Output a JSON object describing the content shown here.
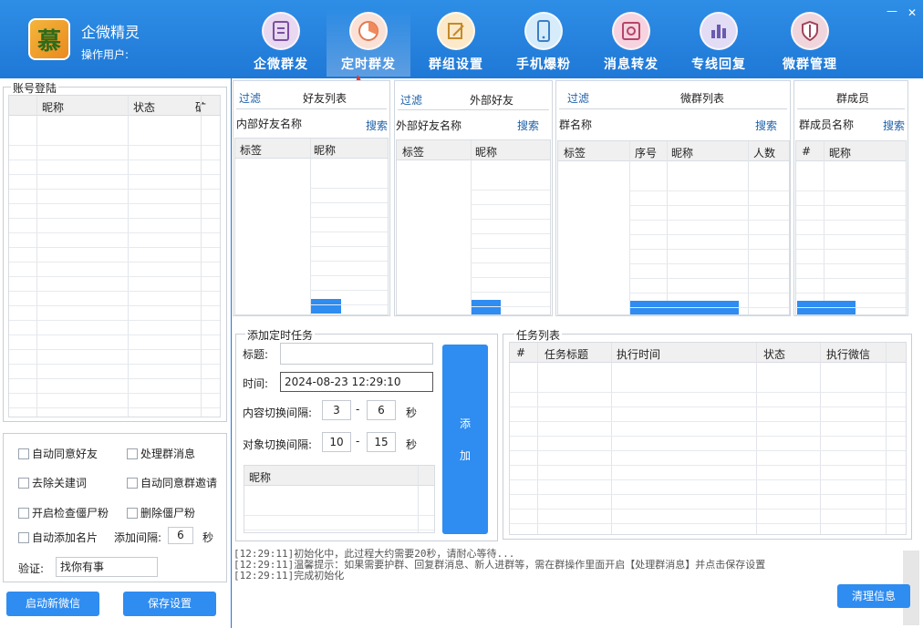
{
  "app": {
    "title": "企微精灵",
    "user_label": "操作用户:",
    "logo_char": "慕"
  },
  "nav": [
    {
      "label": "企微群发",
      "icon": "document-icon"
    },
    {
      "label": "定时群发",
      "icon": "pie-chart-icon"
    },
    {
      "label": "群组设置",
      "icon": "edit-icon"
    },
    {
      "label": "手机爆粉",
      "icon": "phone-icon"
    },
    {
      "label": "消息转发",
      "icon": "safe-icon"
    },
    {
      "label": "专线回复",
      "icon": "bar-chart-icon"
    },
    {
      "label": "微群管理",
      "icon": "shield-icon"
    }
  ],
  "window": {
    "minimize": "—",
    "close": "✕"
  },
  "account": {
    "legend": "账号登陆",
    "columns": [
      "昵称",
      "状态",
      "矿"
    ]
  },
  "friends": {
    "filter": "过滤",
    "title": "好友列表",
    "field_label": "内部好友名称",
    "search": "搜索",
    "columns": [
      "标签",
      "昵称"
    ]
  },
  "external": {
    "filter": "过滤",
    "title": "外部好友",
    "field_label": "外部好友名称",
    "search": "搜索",
    "columns": [
      "标签",
      "昵称"
    ]
  },
  "groups": {
    "filter": "过滤",
    "title": "微群列表",
    "field_label": "群名称",
    "search": "搜索",
    "columns": [
      "标签",
      "序号",
      "昵称",
      "人数"
    ]
  },
  "members": {
    "title": "群成员",
    "field_label": "群成员名称",
    "search": "搜索",
    "columns": [
      "#",
      "昵称"
    ]
  },
  "options": {
    "auto_accept_friend": "自动同意好友",
    "handle_group_msg": "处理群消息",
    "remove_keywords": "去除关建词",
    "auto_accept_group_invite": "自动同意群邀请",
    "check_zombie": "开启检查僵尸粉",
    "delete_zombie": "删除僵尸粉",
    "auto_add_card": "自动添加名片",
    "interval_label": "添加间隔:",
    "interval_value": "6",
    "interval_unit": "秒",
    "verify_label": "验证:",
    "verify_value": "找你有事"
  },
  "bottom_buttons": {
    "start_wechat": "启动新微信",
    "save_settings": "保存设置"
  },
  "task_form": {
    "legend": "添加定时任务",
    "title_label": "标题:",
    "title_value": "",
    "time_label": "时间:",
    "time_value": "2024-08-23 12:29:10",
    "content_interval_label": "内容切换间隔:",
    "content_min": "3",
    "content_max": "6",
    "object_interval_label": "对象切换间隔:",
    "object_min": "10",
    "object_max": "15",
    "dash": "-",
    "unit": "秒",
    "add_button_1": "添",
    "add_button_2": "加",
    "nick_column": "昵称"
  },
  "task_list": {
    "legend": "任务列表",
    "columns": [
      "#",
      "任务标题",
      "执行时间",
      "状态",
      "执行微信"
    ]
  },
  "log": [
    "[12:29:11]初始化中，此过程大约需要20秒，请耐心等待...",
    "[12:29:11]温馨提示：如果需要护群、回复群消息、新人进群等，需在群操作里面开启【处理群消息】并点击保存设置",
    "[12:29:11]完成初始化"
  ],
  "clear_button": "清理信息"
}
